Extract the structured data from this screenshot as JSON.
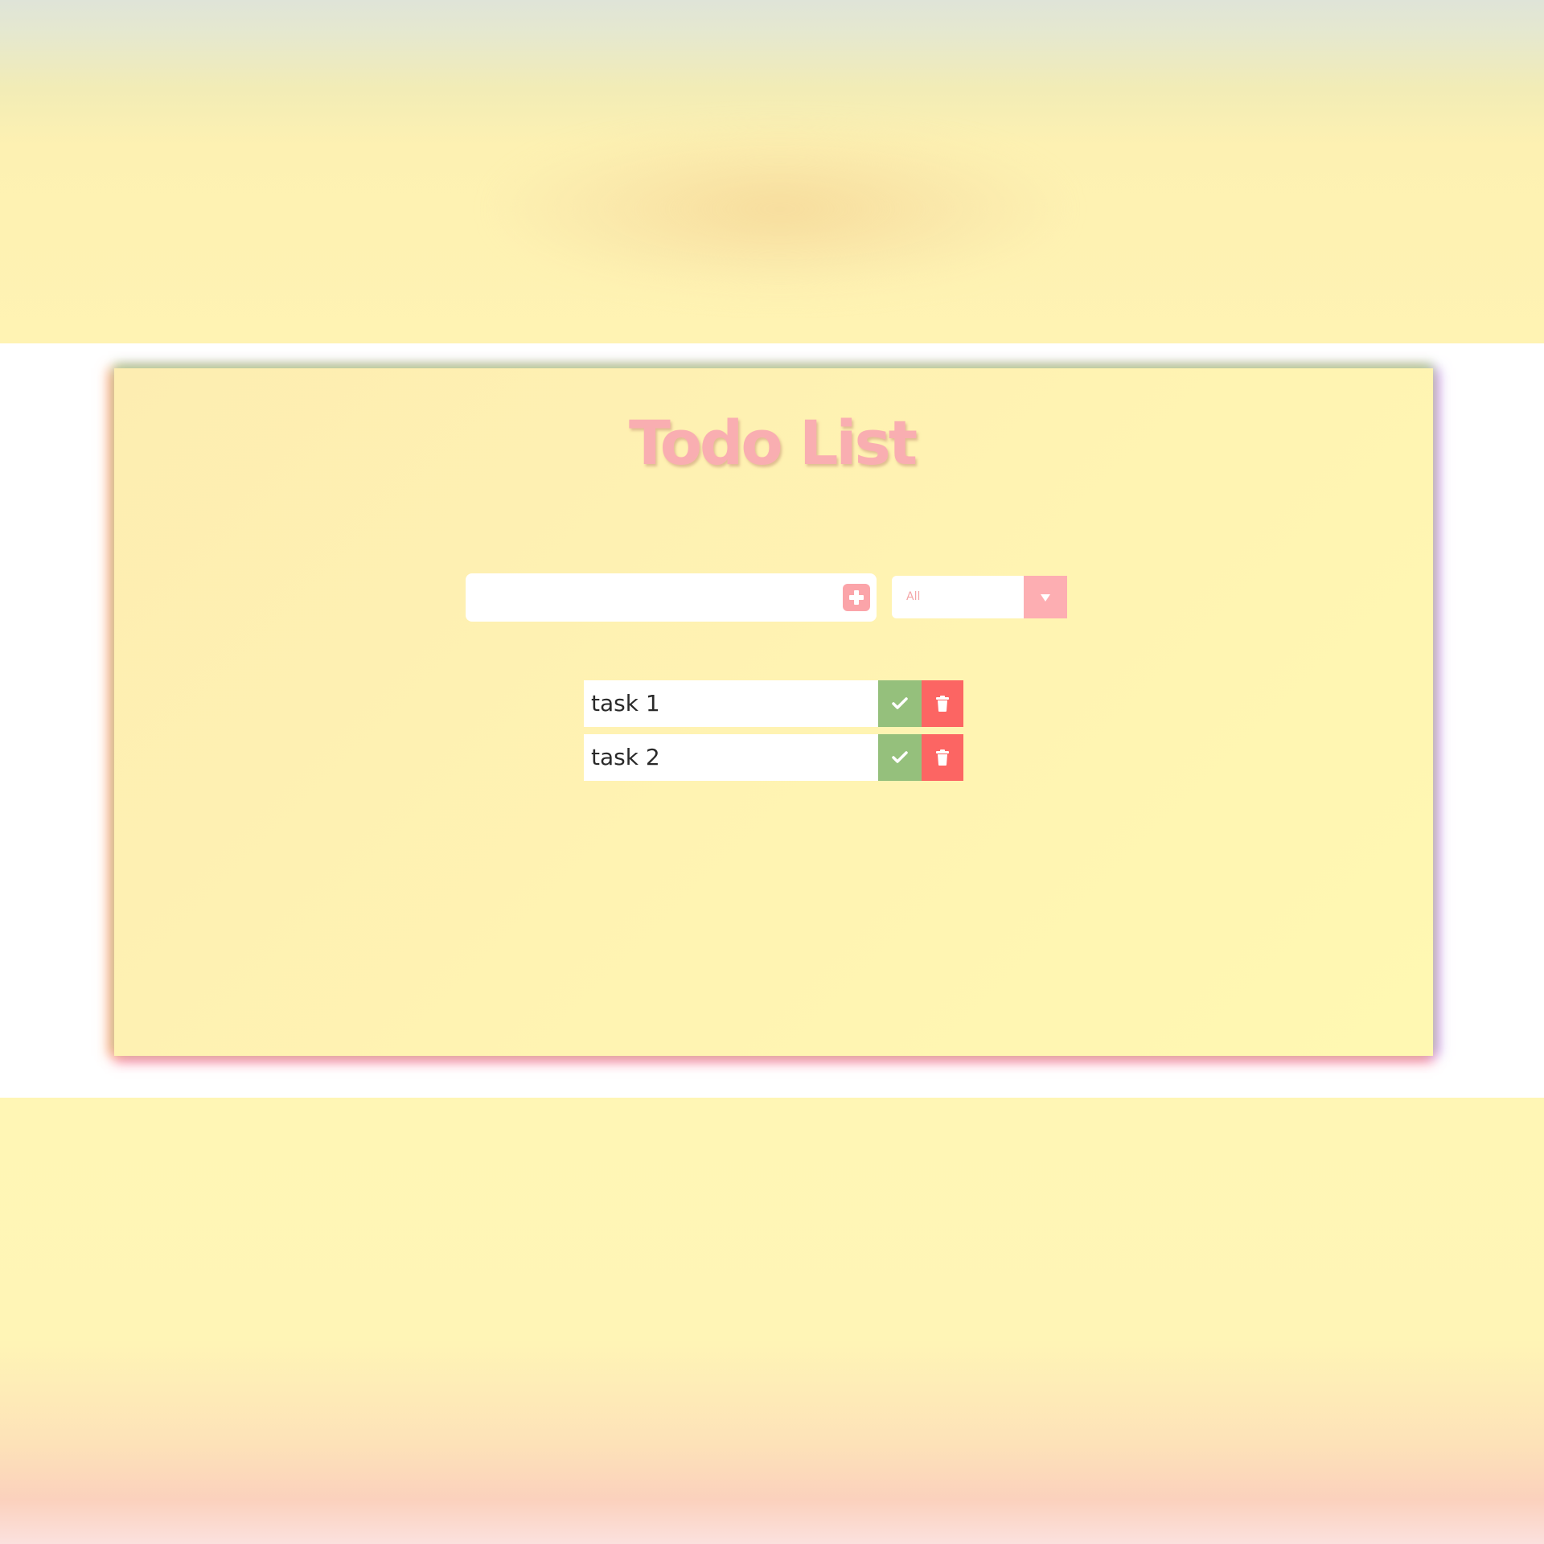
{
  "app": {
    "title": "Todo List"
  },
  "form": {
    "input_value": "",
    "input_placeholder": "",
    "add_icon": "plus-square-icon"
  },
  "filter": {
    "selected": "All",
    "arrow_icon": "triangle-down-icon"
  },
  "todos": [
    {
      "text": "task 1",
      "complete_icon": "check-icon",
      "delete_icon": "trash-icon"
    },
    {
      "text": "task 2",
      "complete_icon": "check-icon",
      "delete_icon": "trash-icon"
    }
  ],
  "colors": {
    "title": "#f9aeb1",
    "accent_pink": "#fba4a9",
    "complete_green": "#95c07c",
    "delete_red": "#fc6563",
    "background_yellow": "#fff6b5",
    "card_yellow": "#fff3b2"
  }
}
